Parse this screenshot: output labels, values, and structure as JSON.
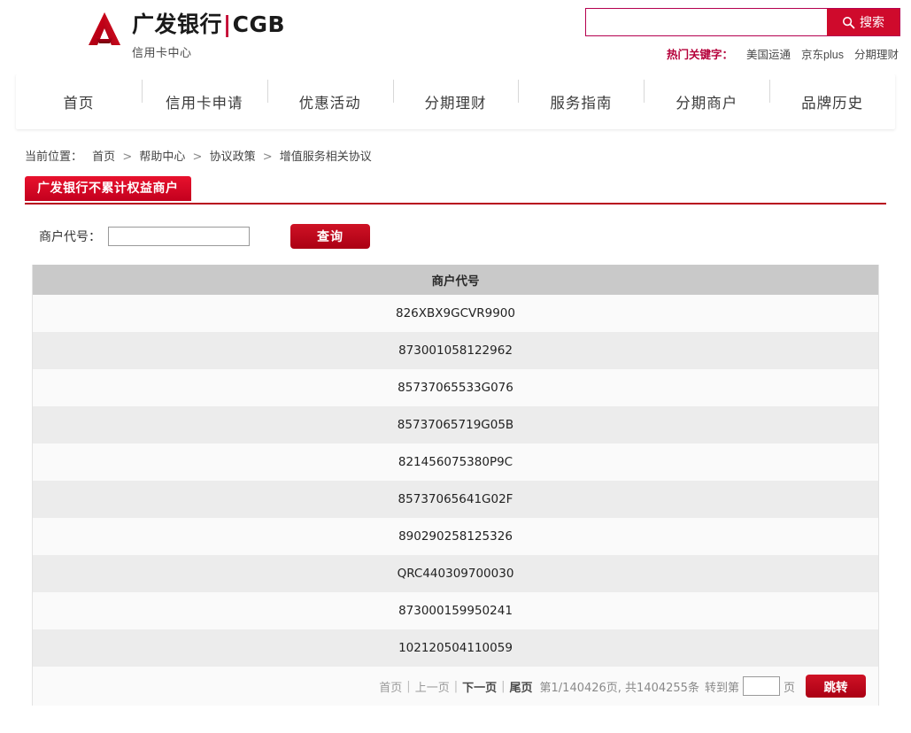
{
  "brand": {
    "logo_icon": "cgb-triangle-logo",
    "name_cn": "广发银行",
    "separator": "|",
    "name_en": "CGB",
    "subtitle": "信用卡中心"
  },
  "search": {
    "value": "",
    "placeholder": "",
    "icon": "search-icon",
    "button_label": "搜索",
    "button_color": "#cf0a2c",
    "border_color": "#b5004f"
  },
  "hot_keywords": {
    "label": "热门关键字：",
    "items": [
      "美国运通",
      "京东plus",
      "分期理财"
    ]
  },
  "nav": {
    "items": [
      {
        "label": "首页"
      },
      {
        "label": "信用卡申请"
      },
      {
        "label": "优惠活动"
      },
      {
        "label": "分期理财"
      },
      {
        "label": "服务指南"
      },
      {
        "label": "分期商户"
      },
      {
        "label": "品牌历史"
      }
    ]
  },
  "breadcrumb": {
    "label": "当前位置：",
    "separator": ">",
    "items": [
      "首页",
      "帮助中心",
      "协议政策",
      "增值服务相关协议"
    ]
  },
  "panel": {
    "tab_label": "广发银行不累计权益商户",
    "tab_color": "#c3001e",
    "underline_color": "#b8021d"
  },
  "query_form": {
    "label": "商户代号：",
    "input_value": "",
    "input_placeholder": "",
    "button_label": "查询",
    "button_color": "#ab0014"
  },
  "table": {
    "columns": [
      "商户代号"
    ],
    "rows": [
      [
        "826XBX9GCVR9900"
      ],
      [
        "873001058122962"
      ],
      [
        "85737065533G076"
      ],
      [
        "85737065719G05B"
      ],
      [
        "821456075380P9C"
      ],
      [
        "85737065641G02F"
      ],
      [
        "890290258125326"
      ],
      [
        "QRC440309700030"
      ],
      [
        "873000159950241"
      ],
      [
        "102120504110059"
      ]
    ],
    "header_bg": "#c9c9c9",
    "row_odd_bg": "#fafafa",
    "row_even_bg": "#ececec"
  },
  "pagination": {
    "first_label": "首页",
    "prev_label": "上一页",
    "next_label": "下一页",
    "last_label": "尾页",
    "divider": "|",
    "info": "第1/140426页, 共1404255条",
    "goto_label": "转到第",
    "goto_value": "",
    "page_unit": "页",
    "jump_label": "跳转",
    "current_page": 1,
    "total_pages": 140426,
    "total_records": 1404255
  }
}
